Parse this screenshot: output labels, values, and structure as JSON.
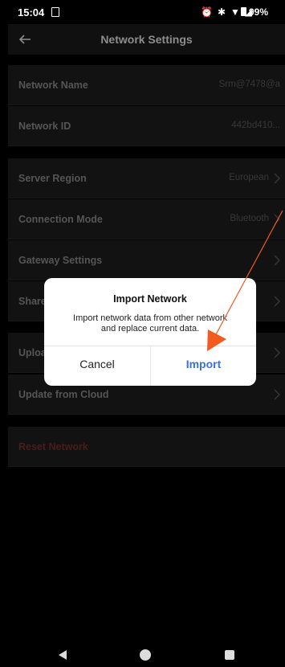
{
  "status_bar": {
    "time": "15:04",
    "icons": [
      "alarm-icon",
      "bluetooth-icon",
      "wifi-icon",
      "signal-icon"
    ],
    "battery": "99%"
  },
  "app_bar": {
    "title": "Network Settings",
    "back_icon": "back-arrow-icon"
  },
  "settings": {
    "network_name": {
      "label": "Network Name",
      "value": "Srm@7478@a"
    },
    "network_id": {
      "label": "Network ID",
      "value": "442bd410..."
    },
    "server_region": {
      "label": "Server Region",
      "value": "European"
    },
    "connection_mode": {
      "label": "Connection Mode",
      "value": "Bluetooth"
    },
    "gateway_settings": {
      "label": "Gateway Settings"
    },
    "share": {
      "label": "Share"
    },
    "upload": {
      "label": "Uploa"
    },
    "update_from_cloud": {
      "label": "Update from Cloud"
    },
    "reset_network": {
      "label": "Reset Network"
    }
  },
  "dialog": {
    "title": "Import Network",
    "message_line1": "Import network data from other network",
    "message_line2": "and replace current data.",
    "cancel_label": "Cancel",
    "import_label": "Import"
  },
  "colors": {
    "accent": "#3b6ee0",
    "annotation_arrow": "#f25a1e",
    "danger": "#4a1c1c"
  },
  "nav_bar": {
    "icons": [
      "nav-back-icon",
      "nav-home-icon",
      "nav-recents-icon"
    ]
  }
}
